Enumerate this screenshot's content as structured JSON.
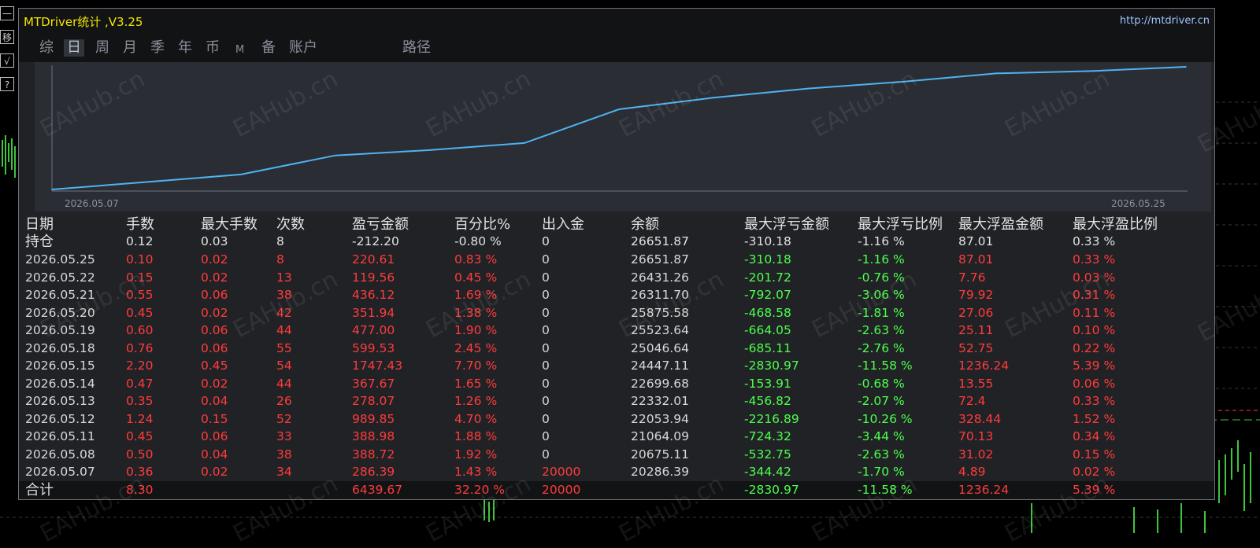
{
  "window": {
    "title": "MTDriver统计 ,V3.25",
    "url": "http://mtdriver.cn"
  },
  "side_buttons": [
    "一",
    "移",
    "√",
    "?"
  ],
  "tabs": [
    {
      "label": "综",
      "active": false
    },
    {
      "label": "日",
      "active": true
    },
    {
      "label": "周",
      "active": false
    },
    {
      "label": "月",
      "active": false
    },
    {
      "label": "季",
      "active": false
    },
    {
      "label": "年",
      "active": false
    },
    {
      "label": "币",
      "active": false
    },
    {
      "label": "M",
      "active": false
    },
    {
      "label": "备",
      "active": false
    },
    {
      "label": "账户",
      "active": false
    },
    {
      "label": "路径",
      "active": false
    }
  ],
  "chart": {
    "x_start": "2026.05.07",
    "x_end": "2026.05.25",
    "line_color": "#4fb3f0",
    "chart_data": {
      "type": "line",
      "x": [
        "2026.05.07",
        "2026.05.08",
        "2026.05.11",
        "2026.05.12",
        "2026.05.13",
        "2026.05.14",
        "2026.05.15",
        "2026.05.18",
        "2026.05.19",
        "2026.05.20",
        "2026.05.21",
        "2026.05.22",
        "2026.05.25"
      ],
      "values": [
        20286.39,
        20675.11,
        21064.09,
        22053.94,
        22332.01,
        22699.68,
        24447.11,
        25046.64,
        25523.64,
        25875.58,
        26311.7,
        26431.26,
        26651.87
      ]
    }
  },
  "watermark": "EAHub.cn",
  "table": {
    "headers": [
      "日期",
      "手数",
      "最大手数",
      "次数",
      "盈亏金额",
      "百分比%",
      "出入金",
      "余额",
      "最大浮亏金额",
      "最大浮亏比例",
      "最大浮盈金额",
      "最大浮盈比例"
    ],
    "holding": {
      "label": "持仓",
      "lots": "0.12",
      "max_lots": "0.03",
      "count": "8",
      "pnl": "-212.20",
      "pct": "-0.80 %",
      "io": "0",
      "balance": "26651.87",
      "max_float_loss": "-310.18",
      "max_float_loss_pct": "-1.16 %",
      "max_float_gain": "87.01",
      "max_float_gain_pct": "0.33 %"
    },
    "rows": [
      {
        "date": "2026.05.25",
        "lots": "0.10",
        "max_lots": "0.02",
        "count": "8",
        "pnl": "220.61",
        "pct": "0.83 %",
        "io": "0",
        "balance": "26651.87",
        "mfl": "-310.18",
        "mflp": "-1.16 %",
        "mfg": "87.01",
        "mfgp": "0.33 %"
      },
      {
        "date": "2026.05.22",
        "lots": "0.15",
        "max_lots": "0.02",
        "count": "13",
        "pnl": "119.56",
        "pct": "0.45 %",
        "io": "0",
        "balance": "26431.26",
        "mfl": "-201.72",
        "mflp": "-0.76 %",
        "mfg": "7.76",
        "mfgp": "0.03 %"
      },
      {
        "date": "2026.05.21",
        "lots": "0.55",
        "max_lots": "0.06",
        "count": "38",
        "pnl": "436.12",
        "pct": "1.69 %",
        "io": "0",
        "balance": "26311.70",
        "mfl": "-792.07",
        "mflp": "-3.06 %",
        "mfg": "79.92",
        "mfgp": "0.31 %"
      },
      {
        "date": "2026.05.20",
        "lots": "0.45",
        "max_lots": "0.02",
        "count": "42",
        "pnl": "351.94",
        "pct": "1.38 %",
        "io": "0",
        "balance": "25875.58",
        "mfl": "-468.58",
        "mflp": "-1.81 %",
        "mfg": "27.06",
        "mfgp": "0.11 %"
      },
      {
        "date": "2026.05.19",
        "lots": "0.60",
        "max_lots": "0.06",
        "count": "44",
        "pnl": "477.00",
        "pct": "1.90 %",
        "io": "0",
        "balance": "25523.64",
        "mfl": "-664.05",
        "mflp": "-2.63 %",
        "mfg": "25.11",
        "mfgp": "0.10 %"
      },
      {
        "date": "2026.05.18",
        "lots": "0.76",
        "max_lots": "0.06",
        "count": "55",
        "pnl": "599.53",
        "pct": "2.45 %",
        "io": "0",
        "balance": "25046.64",
        "mfl": "-685.11",
        "mflp": "-2.76 %",
        "mfg": "52.75",
        "mfgp": "0.22 %"
      },
      {
        "date": "2026.05.15",
        "lots": "2.20",
        "max_lots": "0.45",
        "count": "54",
        "pnl": "1747.43",
        "pct": "7.70 %",
        "io": "0",
        "balance": "24447.11",
        "mfl": "-2830.97",
        "mflp": "-11.58 %",
        "mfg": "1236.24",
        "mfgp": "5.39 %"
      },
      {
        "date": "2026.05.14",
        "lots": "0.47",
        "max_lots": "0.02",
        "count": "44",
        "pnl": "367.67",
        "pct": "1.65 %",
        "io": "0",
        "balance": "22699.68",
        "mfl": "-153.91",
        "mflp": "-0.68 %",
        "mfg": "13.55",
        "mfgp": "0.06 %"
      },
      {
        "date": "2026.05.13",
        "lots": "0.35",
        "max_lots": "0.04",
        "count": "26",
        "pnl": "278.07",
        "pct": "1.26 %",
        "io": "0",
        "balance": "22332.01",
        "mfl": "-456.82",
        "mflp": "-2.07 %",
        "mfg": "72.4",
        "mfgp": "0.33 %"
      },
      {
        "date": "2026.05.12",
        "lots": "1.24",
        "max_lots": "0.15",
        "count": "52",
        "pnl": "989.85",
        "pct": "4.70 %",
        "io": "0",
        "balance": "22053.94",
        "mfl": "-2216.89",
        "mflp": "-10.26 %",
        "mfg": "328.44",
        "mfgp": "1.52 %"
      },
      {
        "date": "2026.05.11",
        "lots": "0.45",
        "max_lots": "0.06",
        "count": "33",
        "pnl": "388.98",
        "pct": "1.88 %",
        "io": "0",
        "balance": "21064.09",
        "mfl": "-724.32",
        "mflp": "-3.44 %",
        "mfg": "70.13",
        "mfgp": "0.34 %"
      },
      {
        "date": "2026.05.08",
        "lots": "0.50",
        "max_lots": "0.04",
        "count": "38",
        "pnl": "388.72",
        "pct": "1.92 %",
        "io": "0",
        "balance": "20675.11",
        "mfl": "-532.75",
        "mflp": "-2.63 %",
        "mfg": "31.02",
        "mfgp": "0.15 %"
      },
      {
        "date": "2026.05.07",
        "lots": "0.36",
        "max_lots": "0.02",
        "count": "34",
        "pnl": "286.39",
        "pct": "1.43 %",
        "io": "20000",
        "balance": "20286.39",
        "mfl": "-344.42",
        "mflp": "-1.70 %",
        "mfg": "4.89",
        "mfgp": "0.02 %"
      }
    ],
    "total": {
      "label": "合计",
      "lots": "8.30",
      "pnl": "6439.67",
      "pct": "32.20 %",
      "io": "20000",
      "mfl": "-2830.97",
      "mflp": "-11.58 %",
      "mfg": "1236.24",
      "mfgp": "5.39 %"
    }
  }
}
